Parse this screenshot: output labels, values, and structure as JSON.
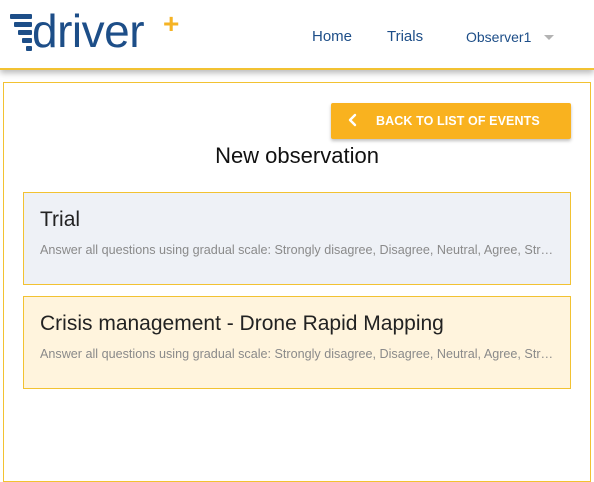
{
  "header": {
    "logo_text": "driver",
    "logo_plus": "+",
    "nav": {
      "home": "Home",
      "trials": "Trials",
      "user": "Observer1"
    }
  },
  "toolbar": {
    "back_label": "BACK TO LIST OF EVENTS",
    "back_icon": "chevron-left-icon"
  },
  "page": {
    "title": "New observation"
  },
  "cards": [
    {
      "title": "Trial",
      "description": "Answer all questions using gradual scale: Strongly disagree, Disagree, Neutral, Agree, Strongly agree"
    },
    {
      "title": "Crisis management - Drone Rapid Mapping",
      "description": "Answer all questions using gradual scale: Strongly disagree, Disagree, Neutral, Agree, Strongly agree"
    }
  ],
  "colors": {
    "brand_blue": "#1d4e88",
    "accent_yellow": "#f9b21f",
    "border_yellow": "#f2c232",
    "card_1_bg": "#eef1f6",
    "card_2_bg": "#fff4dd"
  }
}
